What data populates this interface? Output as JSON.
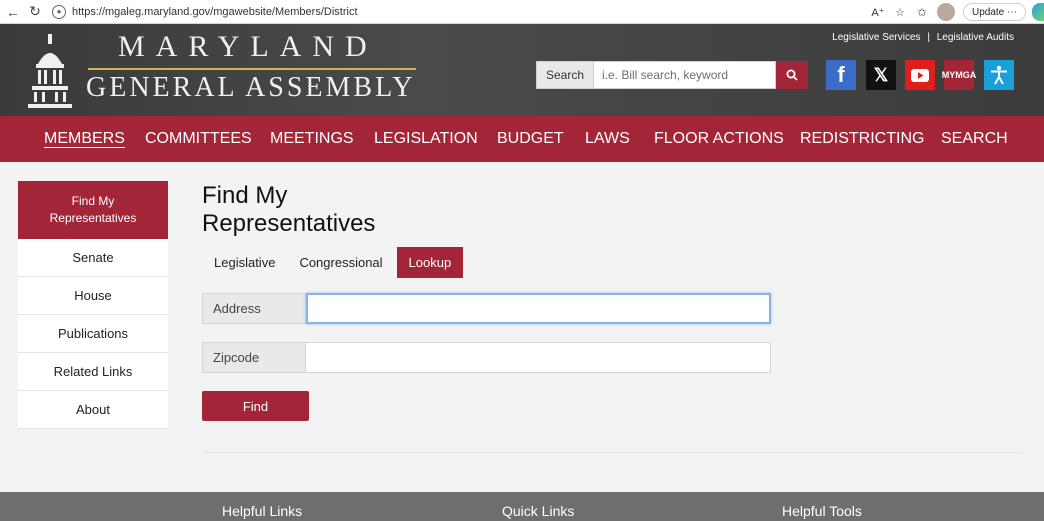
{
  "browser": {
    "url": "https://mgaleg.maryland.gov/mgawebsite/Members/District",
    "update_label": "Update"
  },
  "header": {
    "logo_top": "MARYLAND",
    "logo_bottom": "GENERAL ASSEMBLY",
    "top_links": [
      "Legislative Services",
      "Legislative Audits"
    ],
    "top_links_separator": "|",
    "search": {
      "label": "Search",
      "placeholder": "i.e. Bill search, keyword"
    },
    "social": {
      "mga_line1": "MY",
      "mga_line2": "MGA"
    }
  },
  "nav": {
    "items": [
      "MEMBERS",
      "COMMITTEES",
      "MEETINGS",
      "LEGISLATION",
      "BUDGET",
      "LAWS",
      "FLOOR ACTIONS",
      "REDISTRICTING",
      "SEARCH"
    ],
    "active": "MEMBERS"
  },
  "sidebar": {
    "items": [
      {
        "label": "Find My Representatives",
        "active": true
      },
      {
        "label": "Senate"
      },
      {
        "label": "House"
      },
      {
        "label": "Publications"
      },
      {
        "label": "Related Links"
      },
      {
        "label": "About"
      }
    ]
  },
  "main": {
    "title": "Find My Representatives",
    "tabs": [
      {
        "label": "Legislative"
      },
      {
        "label": "Congressional"
      },
      {
        "label": "Lookup",
        "active": true
      }
    ],
    "fields": {
      "address_label": "Address",
      "address_value": "",
      "zipcode_label": "Zipcode",
      "zipcode_value": ""
    },
    "find_label": "Find"
  },
  "footer": {
    "columns": [
      "Helpful Links",
      "Quick Links",
      "Helpful Tools"
    ]
  },
  "colors": {
    "brand": "#a32638",
    "header_bg": "#3a3a3a",
    "footer_bg": "#6e6e6e"
  }
}
